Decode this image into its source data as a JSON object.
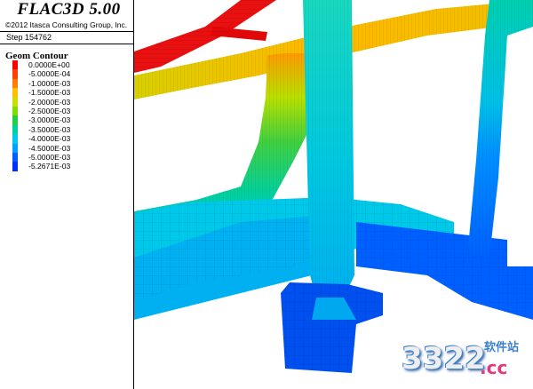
{
  "app": {
    "title": "FLAC3D 5.00",
    "copyright": "©2012 Itasca Consulting Group, Inc.",
    "step": "Step 154762"
  },
  "legend": {
    "title": "Geom Contour",
    "entries": [
      {
        "label": "0.0000E+00",
        "color": "#ff0000"
      },
      {
        "label": "-5.0000E-04",
        "color": "#ff4000"
      },
      {
        "label": "-1.0000E-03",
        "color": "#ff8000"
      },
      {
        "label": "-1.5000E-03",
        "color": "#ffbf00"
      },
      {
        "label": "-2.0000E-03",
        "color": "#c8e000"
      },
      {
        "label": "-2.5000E-03",
        "color": "#7fdc00"
      },
      {
        "label": "-3.0000E-03",
        "color": "#20d040"
      },
      {
        "label": "-3.5000E-03",
        "color": "#00d0a0"
      },
      {
        "label": "-4.0000E-03",
        "color": "#00c8e8"
      },
      {
        "label": "-4.5000E-03",
        "color": "#00a0ff"
      },
      {
        "label": "-5.0000E-03",
        "color": "#0060ff"
      },
      {
        "label": "-5.2671E-03",
        "color": "#0030ff"
      }
    ]
  },
  "watermark": {
    "number": "3322",
    "site": ".cc",
    "chinese": "软件站"
  }
}
